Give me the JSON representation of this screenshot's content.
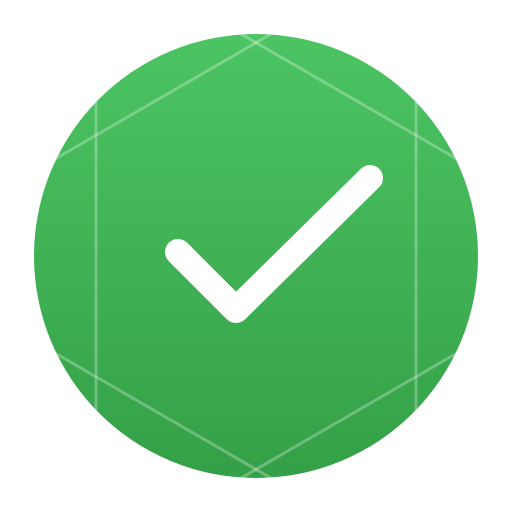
{
  "icon": {
    "name": "checkmark-badge-icon",
    "gradient_top": "#4cc463",
    "gradient_bottom": "#34a047",
    "pattern_color": "#ffffff",
    "checkmark_color": "#ffffff"
  }
}
